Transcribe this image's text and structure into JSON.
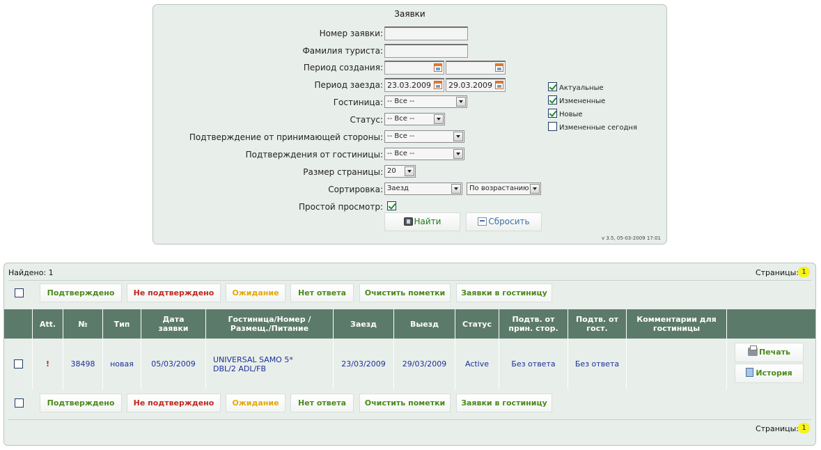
{
  "search": {
    "title": "Заявки",
    "order_number_label": "Номер заявки:",
    "order_number_value": "",
    "tourist_surname_label": "Фамилия туриста:",
    "tourist_surname_value": "",
    "created_period_label": "Период создания:",
    "created_from": "",
    "created_to": "",
    "checkin_period_label": "Период заезда:",
    "checkin_from": "23.03.2009",
    "checkin_to": "29.03.2009",
    "hotel_label": "Гостиница:",
    "hotel_value": "-- Все --",
    "status_label": "Статус:",
    "status_value": "-- Все --",
    "host_confirm_label": "Подтверждение от принимающей стороны:",
    "host_confirm_value": "-- Все --",
    "hotel_confirm_label": "Подтверждения от гостиницы:",
    "hotel_confirm_value": "-- Все --",
    "page_size_label": "Размер страницы:",
    "page_size_value": "20",
    "sort_label": "Сортировка:",
    "sort_field_value": "Заезд",
    "sort_order_value": "По возрастанию",
    "simple_view_label": "Простой просмотр:",
    "simple_view_checked": true,
    "filters": [
      {
        "label": "Актуальные",
        "checked": true
      },
      {
        "label": "Измененные",
        "checked": true
      },
      {
        "label": "Новые",
        "checked": true
      },
      {
        "label": "Измененные сегодня",
        "checked": false
      }
    ],
    "find_label": "Найти",
    "reset_label": "Сбросить",
    "version": "v 3.5, 05-03-2009 17:01"
  },
  "results": {
    "found_label": "Найдено: 1",
    "pages_label": "Страницы:",
    "current_page": "1",
    "actions": {
      "confirmed": "Подтверждено",
      "not_confirmed": "Не подтверждено",
      "waiting": "Ожидание",
      "no_answer": "Нет ответа",
      "clear_marks": "Очистить пометки",
      "to_hotel": "Заявки в гостиницу"
    },
    "columns": {
      "att": "Att.",
      "number": "№",
      "type": "Тип",
      "date": "Дата заявки",
      "hotel": "Гостиница/Номер /Размещ./Питание",
      "checkin": "Заезд",
      "checkout": "Выезд",
      "status": "Статус",
      "host_confirm": "Подтв. от прин. стор.",
      "hotel_confirm": "Подтв. от гост.",
      "comments": "Комментарии для гостиницы"
    },
    "rows": [
      {
        "att": "!",
        "number": "38498",
        "type": "новая",
        "date": "05/03/2009",
        "hotel_line1": "UNIVERSAL SAMO 5*",
        "hotel_line2": "DBL/2 ADL/FB",
        "checkin": "23/03/2009",
        "checkout": "29/03/2009",
        "status": "Active",
        "host_confirm": "Без ответа",
        "hotel_confirm": "Без ответа",
        "comments": "",
        "print_label": "Печать",
        "history_label": "История"
      }
    ]
  }
}
